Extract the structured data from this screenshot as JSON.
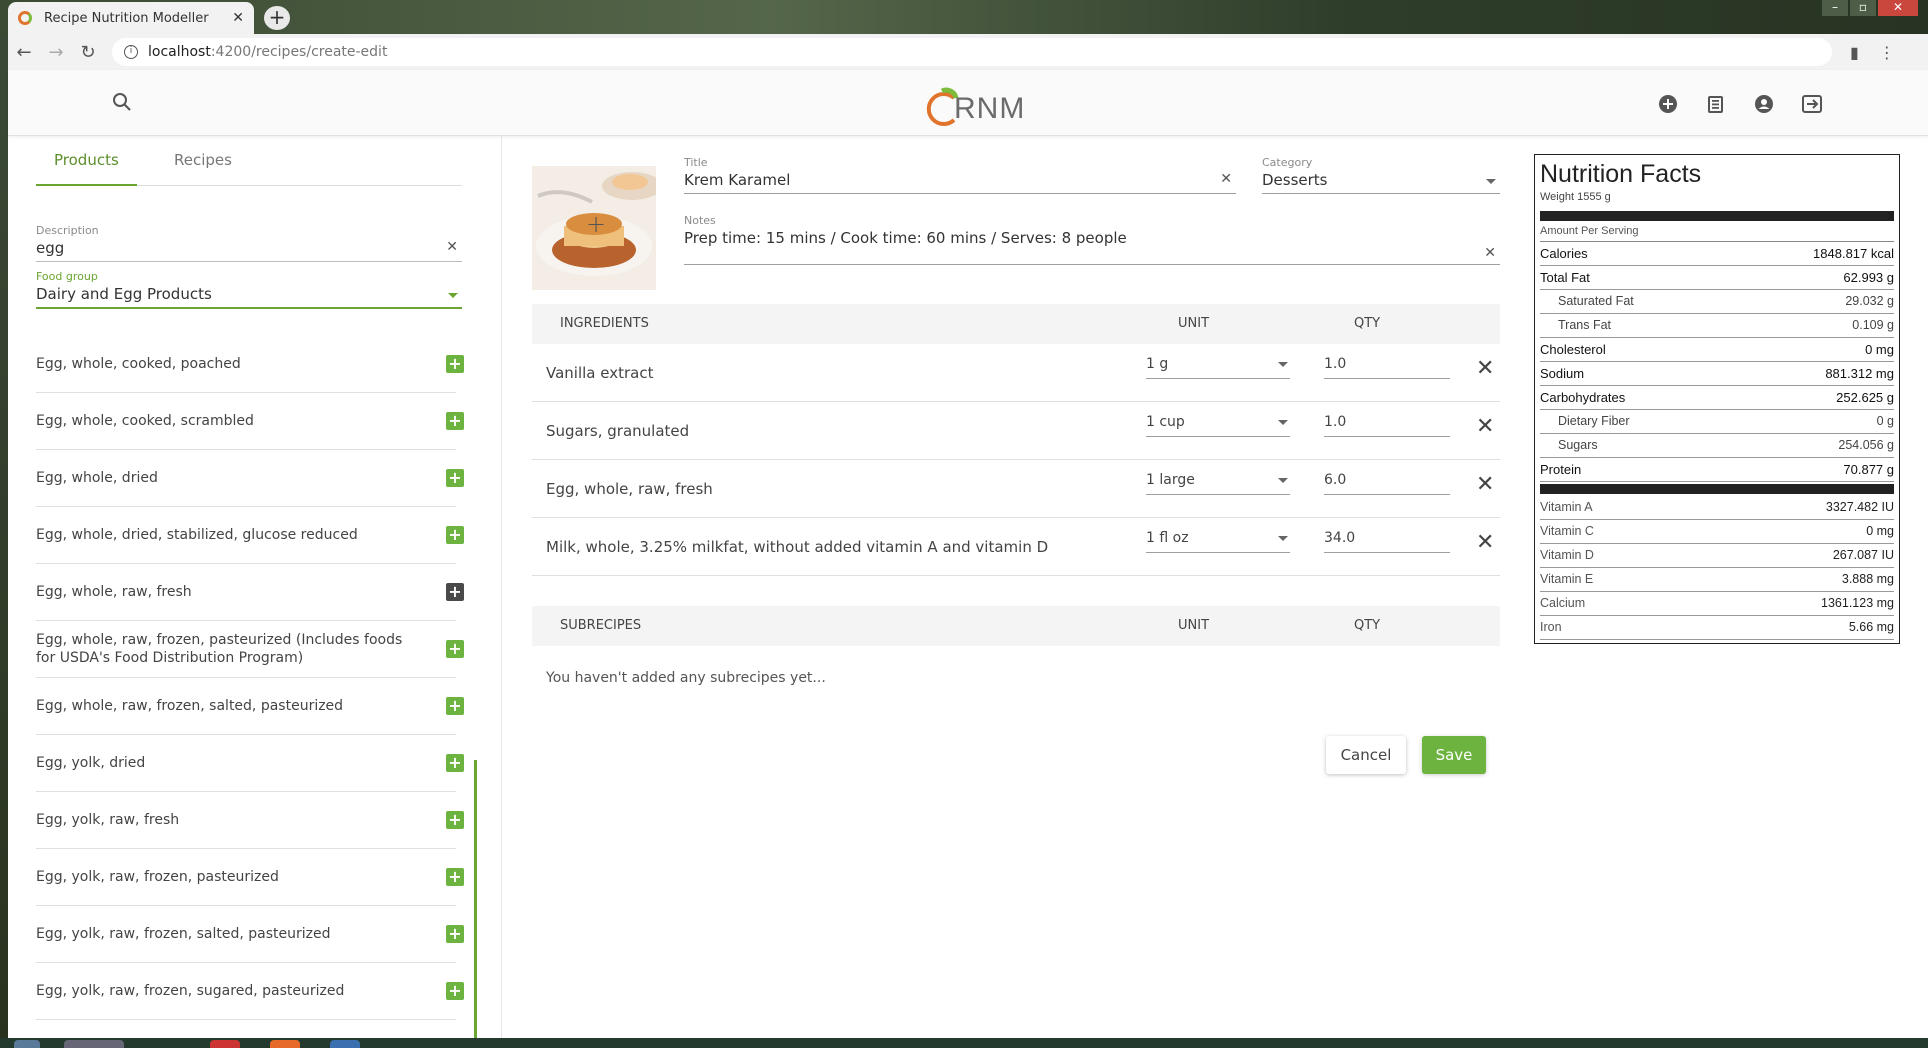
{
  "browser": {
    "tab_title": "Recipe Nutrition Modeller",
    "tab_close": "✕",
    "new_tab": "+",
    "url_host": "localhost",
    "url_path": ":4200/recipes/create-edit"
  },
  "appbar": {
    "logo_text": "RNM"
  },
  "left": {
    "tabs": [
      "Products",
      "Recipes"
    ],
    "description_label": "Description",
    "description_value": "egg",
    "food_group_label": "Food group",
    "food_group_value": "Dairy and Egg Products",
    "products": [
      {
        "name": "Egg, whole, cooked, poached",
        "added": false
      },
      {
        "name": "Egg, whole, cooked, scrambled",
        "added": false
      },
      {
        "name": "Egg, whole, dried",
        "added": false
      },
      {
        "name": "Egg, whole, dried, stabilized, glucose reduced",
        "added": false
      },
      {
        "name": "Egg, whole, raw, fresh",
        "added": true
      },
      {
        "name": "Egg, whole, raw, frozen, pasteurized (Includes foods for USDA's Food Distribution Program)",
        "added": false
      },
      {
        "name": "Egg, whole, raw, frozen, salted, pasteurized",
        "added": false
      },
      {
        "name": "Egg, yolk, dried",
        "added": false
      },
      {
        "name": "Egg, yolk, raw, fresh",
        "added": false
      },
      {
        "name": "Egg, yolk, raw, frozen, pasteurized",
        "added": false
      },
      {
        "name": "Egg, yolk, raw, frozen, salted, pasteurized",
        "added": false
      },
      {
        "name": "Egg, yolk, raw, frozen, sugared, pasteurized",
        "added": false
      }
    ]
  },
  "recipe": {
    "title_label": "Title",
    "title_value": "Krem Karamel",
    "category_label": "Category",
    "category_value": "Desserts",
    "notes_label": "Notes",
    "notes_value": "Prep time: 15 mins / Cook time: 60 mins / Serves: 8 people",
    "ingredients_header": "INGREDIENTS",
    "unit_header": "UNIT",
    "qty_header": "QTY",
    "ingredients": [
      {
        "name": "Vanilla extract",
        "unit": "1 g",
        "qty": "1.0"
      },
      {
        "name": "Sugars, granulated",
        "unit": "1 cup",
        "qty": "1.0"
      },
      {
        "name": "Egg, whole, raw, fresh",
        "unit": "1 large",
        "qty": "6.0"
      },
      {
        "name": "Milk, whole, 3.25% milkfat, without added vitamin A and vitamin D",
        "unit": "1 fl oz",
        "qty": "34.0"
      }
    ],
    "subrecipes_header": "SUBRECIPES",
    "subrecipes_empty": "You haven't added any subrecipes yet...",
    "cancel_label": "Cancel",
    "save_label": "Save"
  },
  "nutrition": {
    "title": "Nutrition Facts",
    "weight": "Weight 1555 g",
    "amount_per_serving": "Amount Per Serving",
    "rows": [
      {
        "label": "Calories",
        "value": "1848.817 kcal",
        "kind": "main"
      },
      {
        "label": "Total Fat",
        "value": "62.993 g",
        "kind": "main"
      },
      {
        "label": "Saturated Fat",
        "value": "29.032 g",
        "kind": "sub"
      },
      {
        "label": "Trans Fat",
        "value": "0.109 g",
        "kind": "sub"
      },
      {
        "label": "Cholesterol",
        "value": "0 mg",
        "kind": "main"
      },
      {
        "label": "Sodium",
        "value": "881.312 mg",
        "kind": "main"
      },
      {
        "label": "Carbohydrates",
        "value": "252.625 g",
        "kind": "main"
      },
      {
        "label": "Dietary Fiber",
        "value": "0 g",
        "kind": "sub"
      },
      {
        "label": "Sugars",
        "value": "254.056 g",
        "kind": "sub"
      },
      {
        "label": "Protein",
        "value": "70.877 g",
        "kind": "main"
      }
    ],
    "vitamins": [
      {
        "label": "Vitamin A",
        "value": "3327.482 IU"
      },
      {
        "label": "Vitamin C",
        "value": "0 mg"
      },
      {
        "label": "Vitamin D",
        "value": "267.087 IU"
      },
      {
        "label": "Vitamin E",
        "value": "3.888 mg"
      },
      {
        "label": "Calcium",
        "value": "1361.123 mg"
      },
      {
        "label": "Iron",
        "value": "5.66 mg"
      }
    ]
  },
  "colors": {
    "accent_green": "#6cb33f",
    "logo_orange": "#e0742c"
  }
}
